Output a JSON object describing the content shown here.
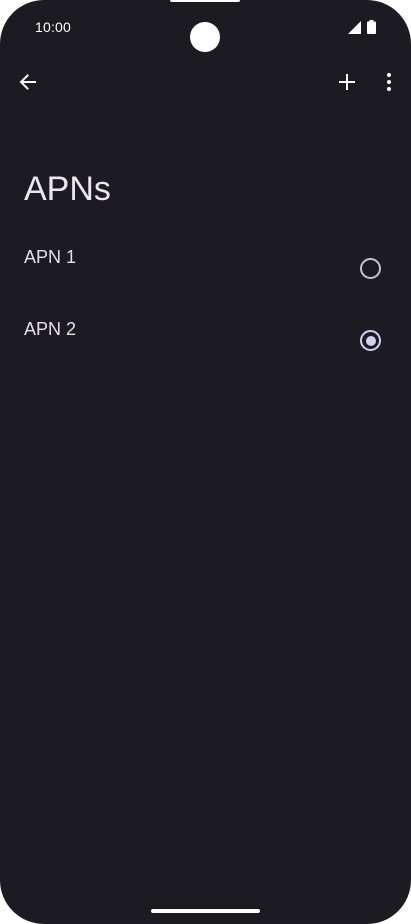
{
  "status_bar": {
    "time": "10:00",
    "signal_icon": "cellular-signal-icon",
    "battery_icon": "battery-icon"
  },
  "app_bar": {
    "back_icon": "arrow-back-icon",
    "add_icon": "plus-icon",
    "more_icon": "more-vert-icon"
  },
  "page": {
    "title": "APNs"
  },
  "apns": [
    {
      "label": "APN 1",
      "selected": false
    },
    {
      "label": "APN 2",
      "selected": true
    }
  ],
  "colors": {
    "background": "#1c1b22",
    "text": "#e6e1e8",
    "radio_selected": "#d4d0f5",
    "radio_unselected": "#c7c3cc"
  }
}
